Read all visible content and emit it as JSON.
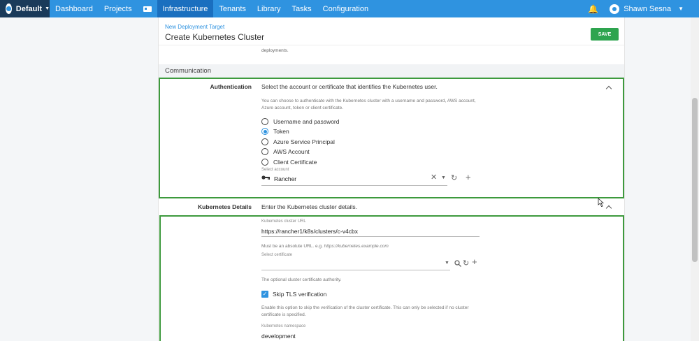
{
  "nav": {
    "space": "Default",
    "items": [
      "Dashboard",
      "Projects",
      "Infrastructure",
      "Tenants",
      "Library",
      "Tasks",
      "Configuration"
    ],
    "active": "Infrastructure",
    "user": "Shawn Sesna"
  },
  "header": {
    "breadcrumb": "New Deployment Target",
    "title": "Create Kubernetes Cluster",
    "save_label": "SAVE",
    "snippet": "deployments."
  },
  "section": {
    "title": "Communication"
  },
  "auth": {
    "label": "Authentication",
    "summary": "Select the account or certificate that identifies the Kubernetes user.",
    "help_line1": "You can choose to authenticate with the Kubernetes cluster with a username and password, AWS account,",
    "help_line2": "Azure account, token or client certificate.",
    "options": [
      "Username and password",
      "Token",
      "Azure Service Principal",
      "AWS Account",
      "Client Certificate"
    ],
    "selected": "Token",
    "account_label": "Select account",
    "account_value": "Rancher"
  },
  "k8s": {
    "label": "Kubernetes Details",
    "summary": "Enter the Kubernetes cluster details.",
    "url_label": "Kubernetes cluster URL",
    "url_value": "https://rancher1/k8s/clusters/c-v4cbx",
    "url_help_prefix": "Must be an absolute URL. e.g.",
    "url_help_example": "https://kubernetes.example.com",
    "cert_label": "Select certificate",
    "cert_help": "The optional cluster certificate authority.",
    "skip_tls_label": "Skip TLS verification",
    "skip_tls_checked": true,
    "skip_help_line1": "Enable this option to skip the verification of the cluster certificate. This can only be selected if no cluster",
    "skip_help_line2": "certificate is specified.",
    "namespace_label": "Kubernetes namespace",
    "namespace_value": "development"
  },
  "colors": {
    "nav": "#2f93e0",
    "save": "#2ea44f",
    "highlight": "#3d9a3d"
  }
}
